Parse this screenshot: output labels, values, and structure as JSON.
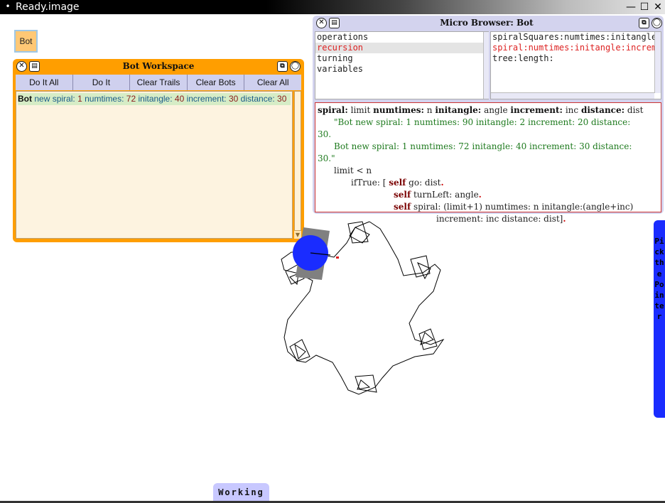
{
  "os": {
    "title": "Ready.image",
    "menu_glyph": "•",
    "min_glyph": "—",
    "max_glyph": "☐",
    "close_glyph": "✕"
  },
  "bot_morph": {
    "label": "Bot"
  },
  "workspace": {
    "title": "Bot Workspace",
    "buttons": [
      "Do It All",
      "Do It",
      "Clear Trails",
      "Clear Bots",
      "Clear All"
    ],
    "code": {
      "t1": "Bot",
      "t2": "new",
      "t3": "spiral:",
      "t4": "1",
      "t5": "numtimes:",
      "t6": "72",
      "t7": "initangle:",
      "t8": "40",
      "t9": "increment:",
      "t10": "30",
      "t11": "distance:",
      "t12": "30"
    }
  },
  "browser": {
    "title": "Micro Browser: Bot",
    "categories": [
      "operations",
      "recursion",
      "turning",
      "variables"
    ],
    "selected_category": "recursion",
    "methods": [
      "spiralSquares:numtimes:initangle:inc",
      "spiral:numtimes:initangle:increment:",
      "tree:length:"
    ],
    "selected_method": "spiral:numtimes:initangle:increment:",
    "code": {
      "sig1": "spiral:",
      "sig2": "limit",
      "sig3": "numtimes:",
      "sig4": "n",
      "sig5": "initangle:",
      "sig6": "angle",
      "sig7": "increment:",
      "sig8": "inc",
      "sig9": "distance:",
      "sig10": "dist",
      "c1": "\"Bot new spiral: 1 numtimes: 90 initangle: 2 increment: 20 distance:",
      "c2": "30.",
      "c3": "Bot new spiral: 1 numtimes: 72 initangle: 40 increment: 30 distance:",
      "c4": "30.\"",
      "l1": "limit < n",
      "l2": "ifTrue: [",
      "self": "self",
      "l2b": "go: dist",
      "l3b": "turnLeft: angle",
      "l4b": "spiral: (limit+1) numtimes: n initangle:(angle+inc)",
      "l5": "increment: inc distance: dist]"
    }
  },
  "flap": {
    "label": "Pick the Pointer"
  },
  "working_tab": {
    "label": "Working"
  },
  "colors": {
    "workspace_frame": "#ff9e00",
    "bot_blue": "#1a2cff",
    "browser_frame": "#d3d3ee",
    "selection_red": "#dd2222"
  }
}
